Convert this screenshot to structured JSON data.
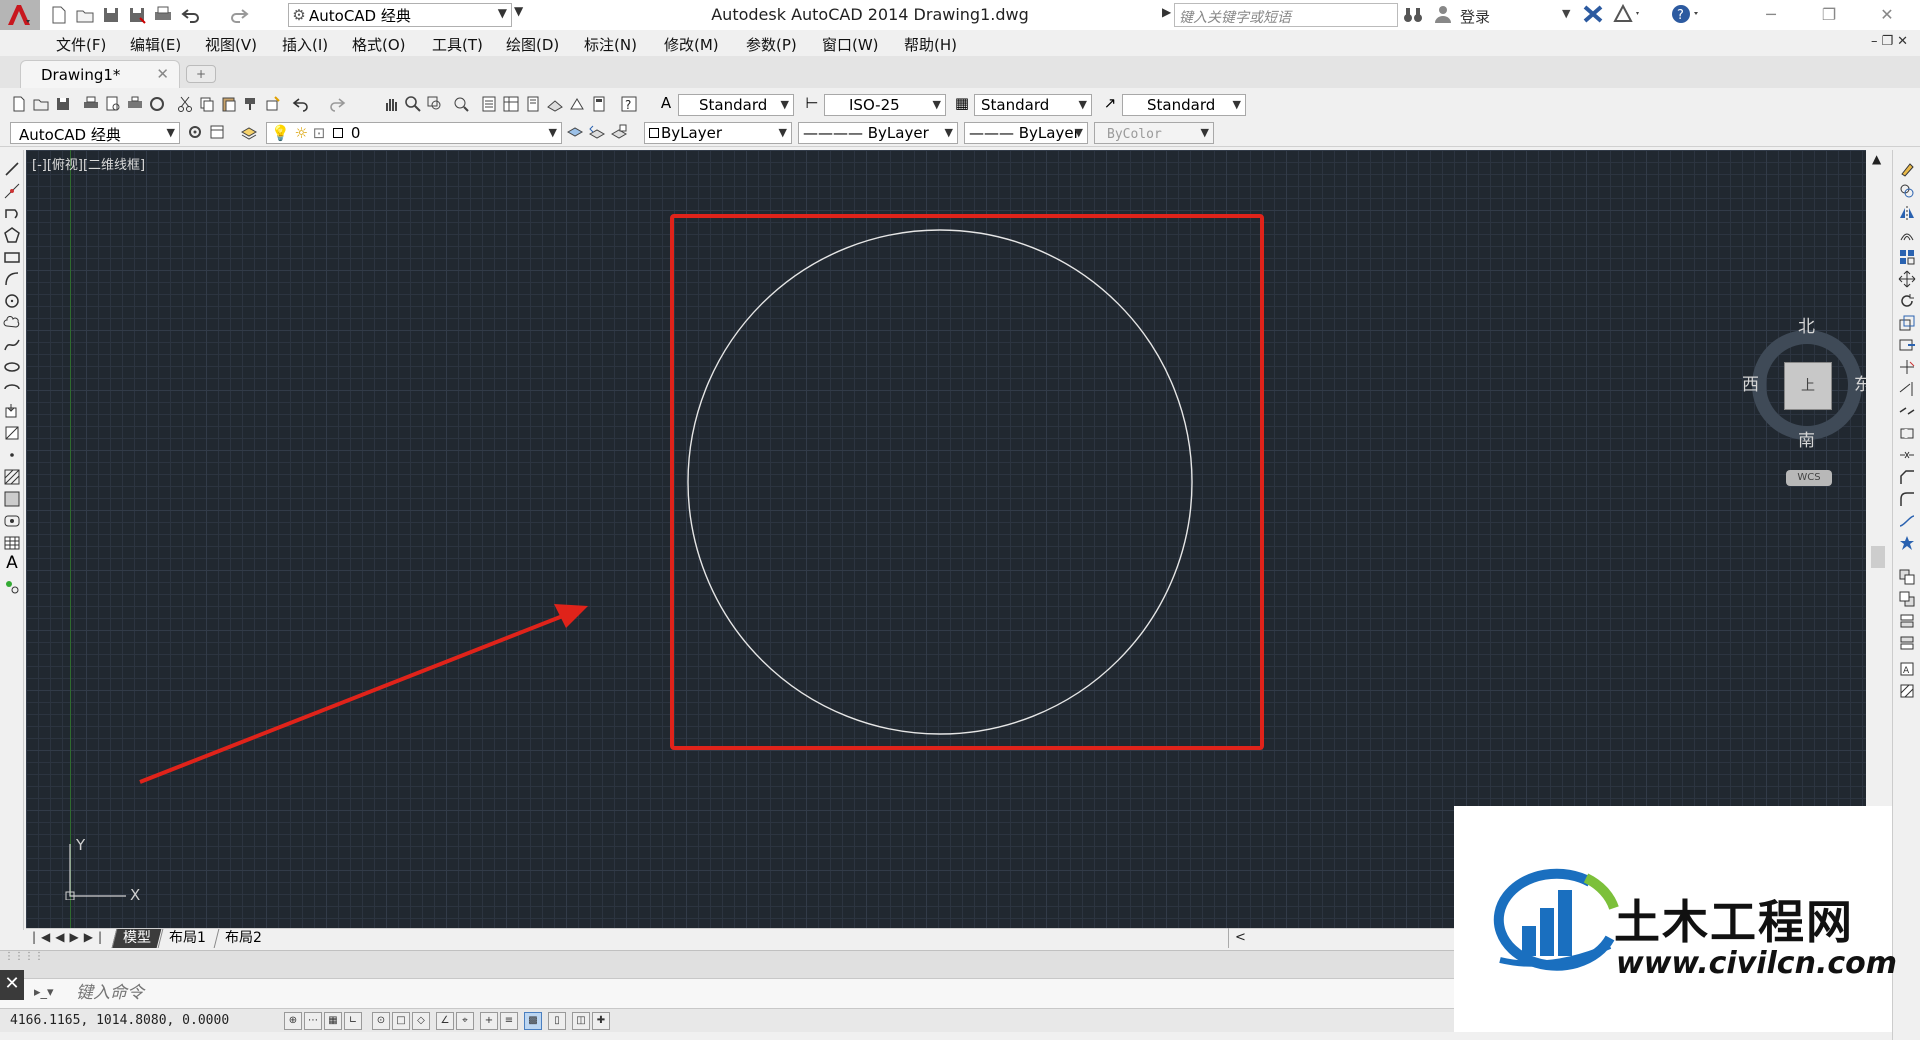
{
  "title_bar": {
    "workspace": "AutoCAD 经典",
    "window_title": "Autodesk AutoCAD 2014    Drawing1.dwg",
    "search_placeholder": "键入关键字或短语",
    "login": "登录",
    "minimize": "─",
    "restore": "❐",
    "close": "✕"
  },
  "menu": [
    "文件(F)",
    "编辑(E)",
    "视图(V)",
    "插入(I)",
    "格式(O)",
    "工具(T)",
    "绘图(D)",
    "标注(N)",
    "修改(M)",
    "参数(P)",
    "窗口(W)",
    "帮助(H)"
  ],
  "file_tab": {
    "label": "Drawing1*",
    "close": "✕"
  },
  "styles": {
    "text_style": "Standard",
    "dim_style": "ISO-25",
    "table_style": "Standard",
    "multileader_style": "Standard"
  },
  "properties": {
    "workspace_combo": "AutoCAD 经典",
    "layer": "0",
    "color": "ByLayer",
    "linetype": "———— ByLayer",
    "lineweight": "——— ByLayer",
    "plot_style": "ByColor"
  },
  "viewport": {
    "label": "[-][俯视][二维线框]",
    "ucs_x": "X",
    "ucs_y": "Y",
    "circle_color": "#e6e6e6",
    "highlight_color": "#e0231a"
  },
  "viewcube": {
    "north": "北",
    "south": "南",
    "east": "东",
    "west": "西",
    "face": "上",
    "wcs": "WCS"
  },
  "layout_tabs": [
    "模型",
    "布局1",
    "布局2"
  ],
  "command": {
    "placeholder": "键入命令",
    "close": "✕"
  },
  "status": {
    "coordinates": "4166.1165,  1014.8080,  0.0000"
  },
  "watermark": {
    "name": "土木工程网",
    "url": "www.civilcn.com"
  }
}
